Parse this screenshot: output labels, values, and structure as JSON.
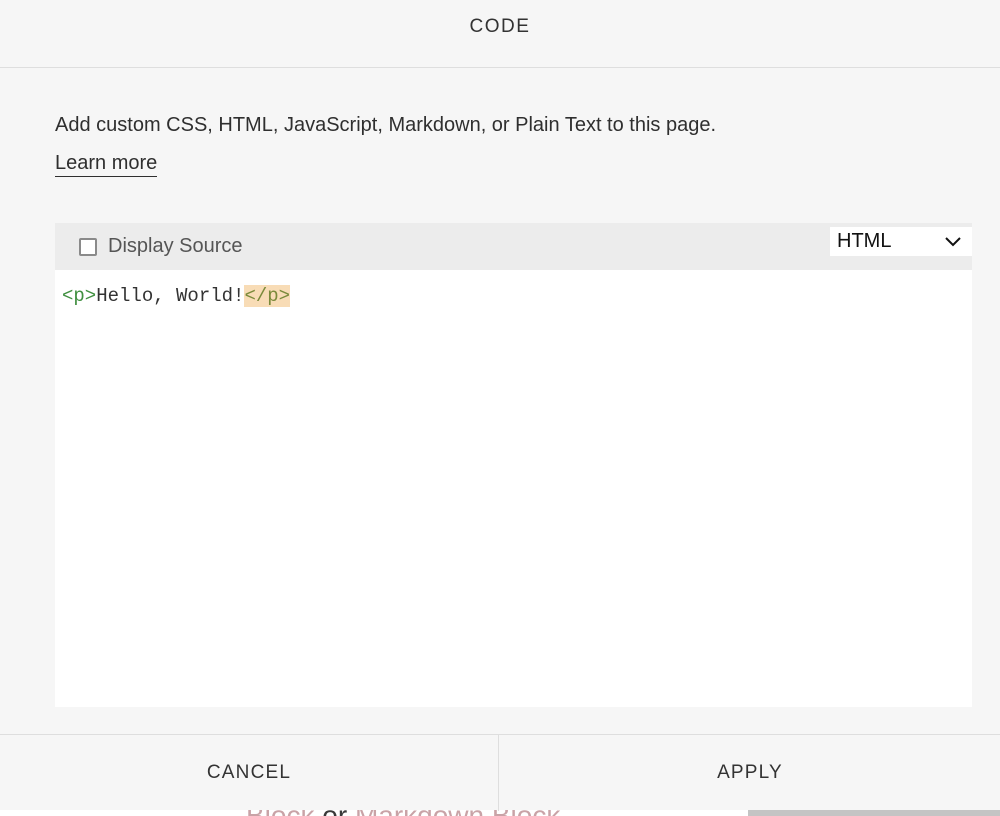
{
  "dialog": {
    "title": "CODE",
    "description": "Add custom CSS, HTML, JavaScript, Markdown, or Plain Text to this page.",
    "learn_more": "Learn more"
  },
  "editor": {
    "display_source_label": "Display Source",
    "display_source_checked": false,
    "language": {
      "selected": "HTML",
      "icon": "chevron-down-icon"
    },
    "code_tokens": [
      {
        "text": "<p>",
        "kind": "tag"
      },
      {
        "text": "Hello, World!",
        "kind": "text"
      },
      {
        "text": "</p>",
        "kind": "tag-highlighted"
      }
    ],
    "colors": {
      "tag": "#3f8f3f",
      "highlight_bg": "#f8dcb6"
    }
  },
  "footer": {
    "cancel": "CANCEL",
    "apply": "APPLY"
  },
  "background_page": {
    "text_start": "Block",
    "text_mid": "or",
    "text_end": "Markdown Block"
  }
}
